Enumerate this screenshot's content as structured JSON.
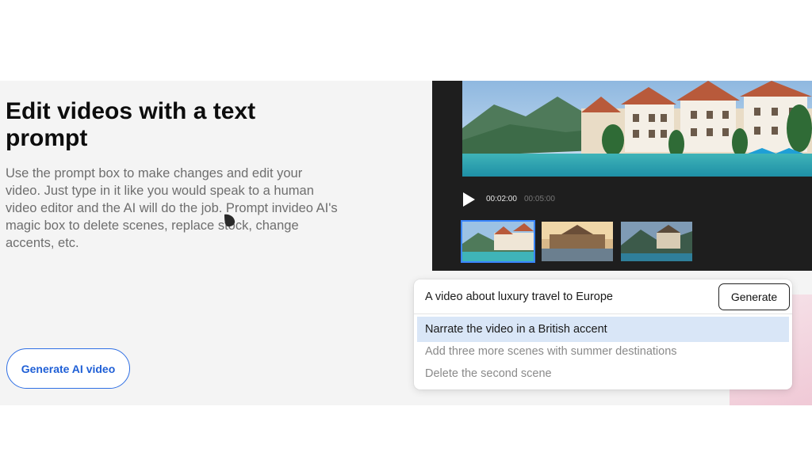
{
  "left": {
    "headline": "Edit videos with a text prompt",
    "description": "Use the prompt box to make changes and edit your video. Just type in it like you would speak to a human video editor and the AI will do the job. Prompt invideo AI's magic box to delete scenes, replace stock, change accents, etc.",
    "cta_label": "Generate AI video"
  },
  "editor": {
    "current_time": "00:02:00",
    "total_time": "00:05:00",
    "play_icon": "play-icon",
    "selected_thumbnail_index": 0
  },
  "prompt_box": {
    "input_text": "A video about luxury travel to Europe",
    "generate_label": "Generate",
    "suggestions": [
      "Narrate the video in a British accent",
      "Add three more scenes with summer destinations",
      "Delete the second scene"
    ],
    "active_suggestion_index": 0
  },
  "colors": {
    "accent": "#2f6fe4",
    "highlight": "#d9e6f7",
    "editor_bg": "#1e1e1e"
  }
}
